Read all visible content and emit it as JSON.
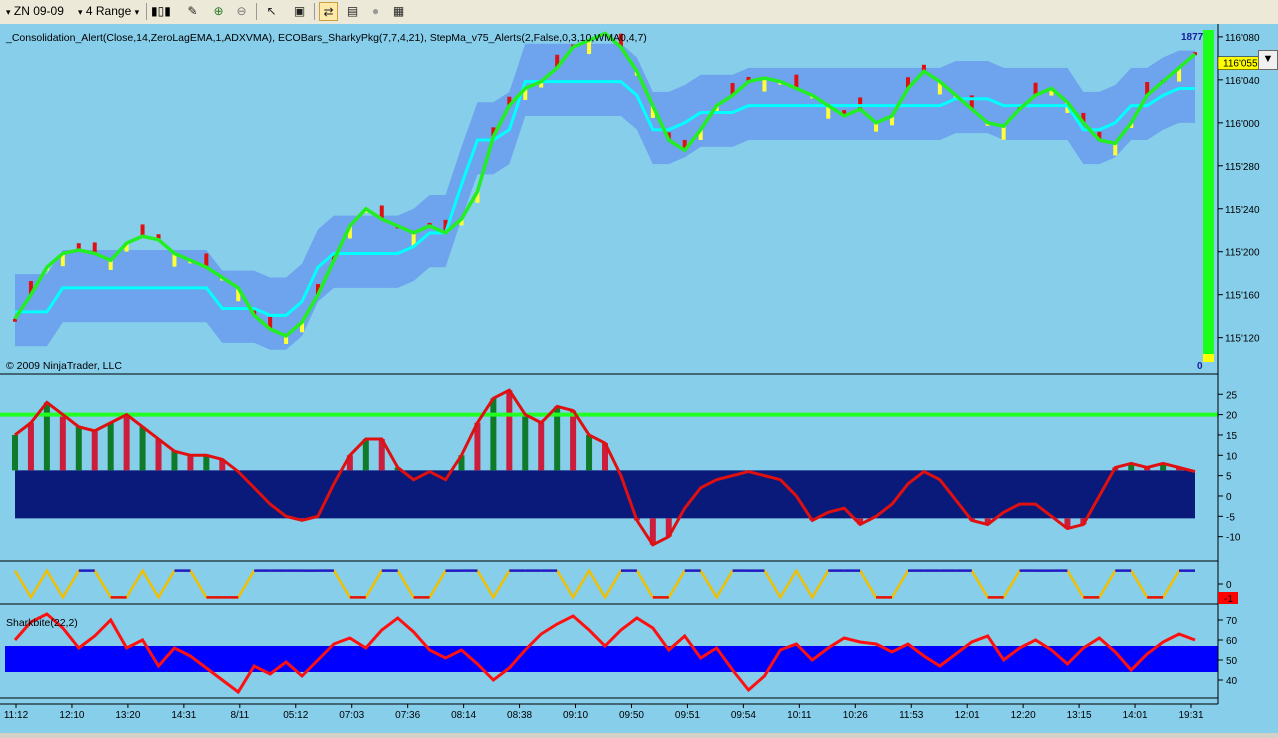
{
  "toolbar": {
    "instrument": "ZN 09-09",
    "period": "4 Range",
    "icons": [
      "candlestick-icon",
      "draw-icon",
      "zoom-in-icon",
      "zoom-out-icon",
      "cursor-icon",
      "data-box-icon",
      "chart-trader-icon",
      "properties-icon",
      "indicator-icon",
      "snapshot-icon"
    ]
  },
  "chart_data": [
    {
      "type": "line",
      "panel": "price",
      "indicator_label": "_Consolidation_Alert(Close,14,ZeroLagEMA,1,ADXVMA), ECOBars_SharkyPkg(7,7,4,21), StepMa_v75_Alerts(2,False,0,3,10,WMA0,4,7)",
      "copyright": "© 2009 NinjaTrader, LLC",
      "y_ticks": [
        "116'080",
        "116'040",
        "116'000",
        "115'280",
        "115'240",
        "115'200",
        "115'160",
        "115'120"
      ],
      "y_tick_values": [
        116.25,
        116.125,
        116.0,
        115.875,
        115.75,
        115.625,
        115.5,
        115.375
      ],
      "current_price": "116'055",
      "current_price_value": 116.172,
      "volume_top": "1877",
      "volume_bottom": "0",
      "ylim": [
        115.31,
        116.27
      ],
      "series": [
        {
          "role": "zerolag",
          "values": [
            115.43,
            115.5,
            115.58,
            115.62,
            115.63,
            115.62,
            115.6,
            115.65,
            115.67,
            115.66,
            115.62,
            115.6,
            115.58,
            115.55,
            115.52,
            115.44,
            115.4,
            115.38,
            115.42,
            115.5,
            115.6,
            115.7,
            115.75,
            115.72,
            115.7,
            115.68,
            115.7,
            115.68,
            115.72,
            115.8,
            115.96,
            116.05,
            116.1,
            116.12,
            116.16,
            116.22,
            116.24,
            116.26,
            116.22,
            116.15,
            116.05,
            115.95,
            115.92,
            115.98,
            116.05,
            116.08,
            116.12,
            116.13,
            116.12,
            116.1,
            116.08,
            116.05,
            116.02,
            116.04,
            116.0,
            116.02,
            116.1,
            116.15,
            116.12,
            116.08,
            116.04,
            116.0,
            115.99,
            116.04,
            116.08,
            116.1,
            116.06,
            116.0,
            115.95,
            115.94,
            116.0,
            116.08,
            116.12,
            116.16,
            116.2
          ]
        },
        {
          "role": "stepma",
          "values": [
            115.45,
            115.45,
            115.45,
            115.52,
            115.52,
            115.52,
            115.52,
            115.52,
            115.52,
            115.52,
            115.52,
            115.52,
            115.52,
            115.46,
            115.46,
            115.46,
            115.44,
            115.44,
            115.48,
            115.58,
            115.62,
            115.62,
            115.62,
            115.62,
            115.62,
            115.64,
            115.68,
            115.68,
            115.82,
            115.95,
            115.95,
            115.98,
            116.12,
            116.12,
            116.12,
            116.12,
            116.12,
            116.12,
            116.12,
            116.08,
            115.98,
            115.98,
            116.0,
            116.03,
            116.03,
            116.03,
            116.05,
            116.05,
            116.05,
            116.05,
            116.05,
            116.05,
            116.05,
            116.05,
            116.05,
            116.05,
            116.05,
            116.05,
            116.05,
            116.07,
            116.07,
            116.07,
            116.05,
            116.05,
            116.05,
            116.05,
            116.05,
            115.98,
            115.98,
            116.0,
            116.05,
            116.05,
            116.08,
            116.1,
            116.1
          ]
        }
      ]
    },
    {
      "type": "bar",
      "panel": "oscillator",
      "y_ticks": [
        "25",
        "20",
        "15",
        "10",
        "5",
        "0",
        "-5",
        "-10"
      ],
      "y_tick_values": [
        25,
        20,
        15,
        10,
        5,
        0,
        -5,
        -10
      ],
      "ylim": [
        -15,
        29
      ],
      "threshold": 20,
      "band": [
        -5.5,
        6.3
      ],
      "values": [
        15,
        18,
        23,
        20,
        17,
        16,
        18,
        20,
        17,
        14,
        11,
        10,
        10,
        9,
        6,
        2,
        -2,
        -5,
        -6,
        -5,
        3,
        10,
        14,
        14,
        7,
        4,
        6,
        4,
        10,
        18,
        24,
        26,
        20,
        18,
        22,
        21,
        15,
        13,
        5,
        -6,
        -12,
        -10,
        -3,
        2,
        4,
        5,
        6,
        5,
        4,
        0,
        -6,
        -4,
        -3,
        -7,
        -5,
        -2,
        3,
        6,
        4,
        -1,
        -6,
        -7,
        -4,
        -2,
        -2,
        -5,
        -8,
        -7,
        0,
        7,
        8,
        7,
        8,
        7,
        6
      ]
    },
    {
      "type": "line",
      "panel": "signal",
      "y_ticks": [
        "0"
      ],
      "y_tick_values": [
        0
      ],
      "current_value": "-1",
      "ylim": [
        -1.2,
        1.2
      ],
      "values": [
        1,
        -1,
        1,
        -1,
        1,
        1,
        -1,
        -1,
        1,
        -1,
        1,
        1,
        -1,
        -1,
        -1,
        1,
        1,
        1,
        1,
        1,
        1,
        -1,
        -1,
        1,
        1,
        -1,
        -1,
        1,
        1,
        1,
        -1,
        1,
        1,
        1,
        1,
        -1,
        1,
        -1,
        1,
        1,
        -1,
        -1,
        1,
        1,
        -1,
        1,
        1,
        1,
        -1,
        1,
        -1,
        1,
        1,
        1,
        -1,
        -1,
        1,
        1,
        1,
        1,
        1,
        -1,
        -1,
        1,
        1,
        1,
        1,
        -1,
        -1,
        1,
        1,
        -1,
        -1,
        1,
        1
      ]
    },
    {
      "type": "line",
      "panel": "sharkbite",
      "indicator_label": "Sharkbite(22,2)",
      "y_ticks": [
        "70",
        "60",
        "50",
        "40"
      ],
      "y_tick_values": [
        70,
        60,
        50,
        40
      ],
      "ylim": [
        33,
        76
      ],
      "band": [
        44,
        57
      ],
      "values": [
        60,
        69,
        73,
        66,
        56,
        62,
        70,
        56,
        60,
        47,
        56,
        52,
        46,
        40,
        34,
        47,
        43,
        49,
        42,
        50,
        58,
        61,
        56,
        65,
        71,
        64,
        55,
        51,
        55,
        48,
        40,
        46,
        55,
        63,
        68,
        72,
        65,
        57,
        65,
        71,
        66,
        55,
        62,
        51,
        56,
        45,
        35,
        42,
        55,
        58,
        50,
        56,
        61,
        59,
        58,
        54,
        58,
        52,
        47,
        53,
        59,
        62,
        50,
        56,
        60,
        55,
        48,
        56,
        61,
        54,
        45,
        53,
        59,
        63,
        60
      ]
    },
    {
      "type": "table",
      "panel": "time-axis",
      "x_ticks": [
        "11:12",
        "12:10",
        "13:20",
        "14:31",
        "8/11",
        "05:12",
        "07:03",
        "07:36",
        "08:14",
        "08:38",
        "09:10",
        "09:50",
        "09:51",
        "09:54",
        "10:11",
        "10:26",
        "11:53",
        "12:01",
        "12:20",
        "13:15",
        "14:01",
        "19:31"
      ]
    }
  ]
}
